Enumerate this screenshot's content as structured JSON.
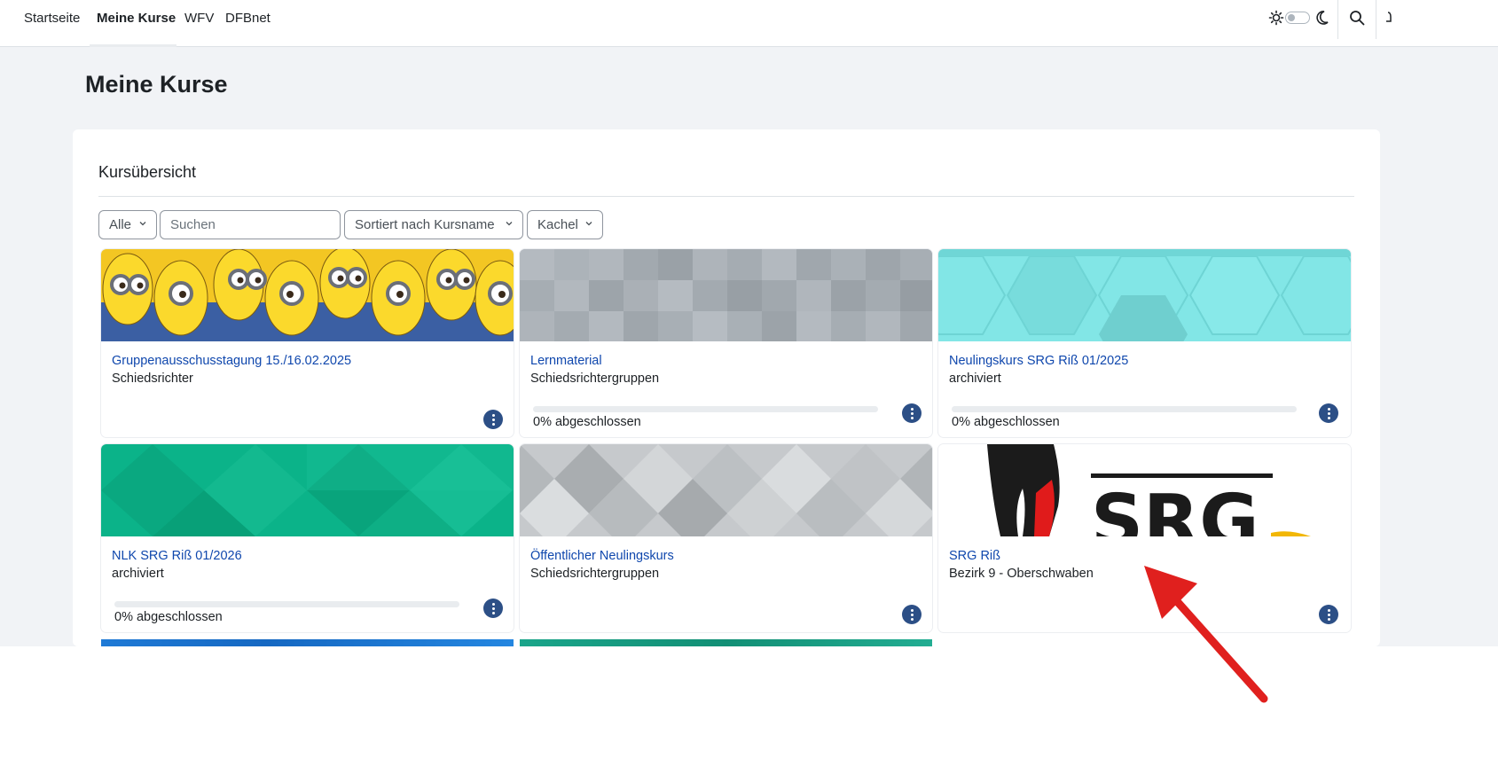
{
  "nav": {
    "items": [
      "Startseite",
      "Meine Kurse",
      "WFV",
      "DFBnet"
    ],
    "active": "Meine Kurse",
    "icons": [
      "sun-icon",
      "theme-switch",
      "moon-icon",
      "search-icon",
      "bell-icon"
    ]
  },
  "page": {
    "title": "Meine Kurse"
  },
  "overview": {
    "title": "Kursübersicht",
    "filter_label": "Alle",
    "search_placeholder": "Suchen",
    "sort_label": "Sortiert nach Kursname",
    "view_label": "Kachel"
  },
  "courses": [
    {
      "name": "Gruppenausschusstagung 15./16.02.2025",
      "category": "Schiedsrichter",
      "progress": null,
      "image": "minions-photo"
    },
    {
      "name": "Lernmaterial",
      "category": "Schiedsrichtergruppen",
      "progress": 0,
      "progress_label": "0% abgeschlossen",
      "image": "grey-squares-pattern"
    },
    {
      "name": "Neulingskurs SRG Riß 01/2025",
      "category": "archiviert",
      "progress": 0,
      "progress_label": "0% abgeschlossen",
      "image": "cyan-hexagon-pattern"
    },
    {
      "name": "NLK SRG Riß 01/2026",
      "category": "archiviert",
      "progress": 0,
      "progress_label": "0% abgeschlossen",
      "image": "green-triangle-pattern"
    },
    {
      "name": "Öffentlicher Neulingskurs",
      "category": "Schiedsrichtergruppen",
      "progress": null,
      "image": "grey-diamond-pattern"
    },
    {
      "name": "SRG Riß",
      "category": "Bezirk 9 - Oberschwaben",
      "progress": null,
      "image": "srg-logo"
    }
  ],
  "colors": {
    "link": "#0f47ad",
    "menu_button": "#2c4f86",
    "page_bg": "#f1f3f6",
    "annotation_arrow": "#e0201e"
  }
}
